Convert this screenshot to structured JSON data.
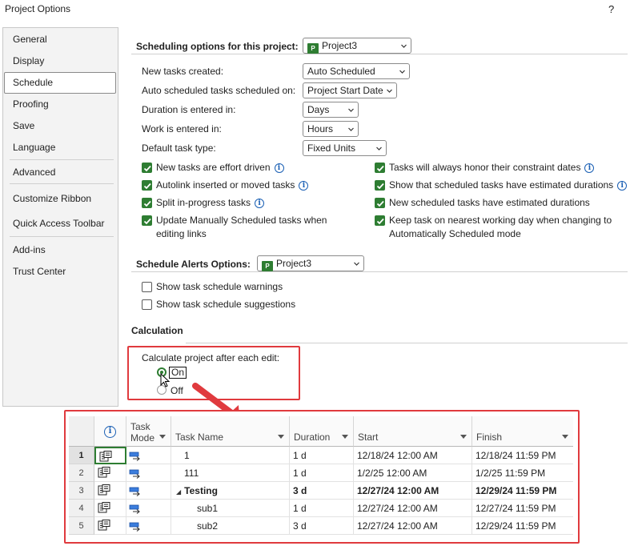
{
  "window": {
    "title": "Project Options",
    "help": "?"
  },
  "nav": {
    "items": [
      {
        "label": "General"
      },
      {
        "label": "Display"
      },
      {
        "label": "Schedule"
      },
      {
        "label": "Proofing"
      },
      {
        "label": "Save"
      },
      {
        "label": "Language"
      },
      {
        "label": "Advanced"
      },
      {
        "label": "Customize Ribbon"
      },
      {
        "label": "Quick Access Toolbar"
      },
      {
        "label": "Add-ins"
      },
      {
        "label": "Trust Center"
      }
    ],
    "selected": "Schedule"
  },
  "scheduling": {
    "heading": "Scheduling options for this project:",
    "project_select": "Project3",
    "fields": [
      {
        "label": "New tasks created:",
        "value": "Auto Scheduled"
      },
      {
        "label": "Auto scheduled tasks scheduled on:",
        "value": "Project Start Date"
      },
      {
        "label": "Duration is entered in:",
        "value": "Days"
      },
      {
        "label": "Work is entered in:",
        "value": "Hours"
      },
      {
        "label": "Default task type:",
        "value": "Fixed Units"
      }
    ],
    "checks_left": [
      {
        "label": "New tasks are effort driven",
        "checked": true,
        "info": true
      },
      {
        "label": "Autolink inserted or moved tasks",
        "checked": true,
        "info": true
      },
      {
        "label": "Split in-progress tasks",
        "checked": true,
        "info": true
      },
      {
        "label": "Update Manually Scheduled tasks when",
        "label2": "editing links",
        "checked": true,
        "info": false
      }
    ],
    "checks_right": [
      {
        "label": "Tasks will always honor their constraint dates",
        "checked": true,
        "info": true
      },
      {
        "label": "Show that scheduled tasks have estimated durations",
        "checked": true,
        "info": true
      },
      {
        "label": "New scheduled tasks have estimated durations",
        "checked": true,
        "info": false
      },
      {
        "label": "Keep task on nearest working day when changing to",
        "label2": "Automatically Scheduled mode",
        "checked": true,
        "info": false
      }
    ]
  },
  "alerts": {
    "heading": "Schedule Alerts Options:",
    "project_select": "Project3",
    "checks": [
      {
        "label": "Show task schedule warnings",
        "checked": false
      },
      {
        "label": "Show task schedule suggestions",
        "checked": false
      }
    ]
  },
  "calculation": {
    "heading": "Calculation",
    "prompt": "Calculate project after each edit:",
    "options": [
      {
        "label": "On",
        "selected": true
      },
      {
        "label": "Off",
        "selected": false
      }
    ]
  },
  "task_table": {
    "columns": [
      "Task Mode",
      "Task Name",
      "Duration",
      "Start",
      "Finish"
    ],
    "mode_header_line1": "Task",
    "mode_header_line2": "Mode",
    "rows": [
      {
        "num": "1",
        "name": "1",
        "duration": "1 d",
        "start": "12/18/24 12:00 AM",
        "finish": "12/18/24 11:59 PM",
        "summary": false,
        "indent": 1
      },
      {
        "num": "2",
        "name": "111",
        "duration": "1 d",
        "start": "1/2/25 12:00 AM",
        "finish": "1/2/25 11:59 PM",
        "summary": false,
        "indent": 1
      },
      {
        "num": "3",
        "name": "Testing",
        "duration": "3 d",
        "start": "12/27/24 12:00 AM",
        "finish": "12/29/24 11:59 PM",
        "summary": true,
        "indent": 0
      },
      {
        "num": "4",
        "name": "sub1",
        "duration": "1 d",
        "start": "12/27/24 12:00 AM",
        "finish": "12/27/24 11:59 PM",
        "summary": false,
        "indent": 2
      },
      {
        "num": "5",
        "name": "sub2",
        "duration": "3 d",
        "start": "12/27/24 12:00 AM",
        "finish": "12/29/24 11:59 PM",
        "summary": false,
        "indent": 2
      }
    ]
  },
  "colors": {
    "accent_green": "#2e7d32",
    "highlight_red": "#e03a3e",
    "info_blue": "#1a5fb4"
  }
}
